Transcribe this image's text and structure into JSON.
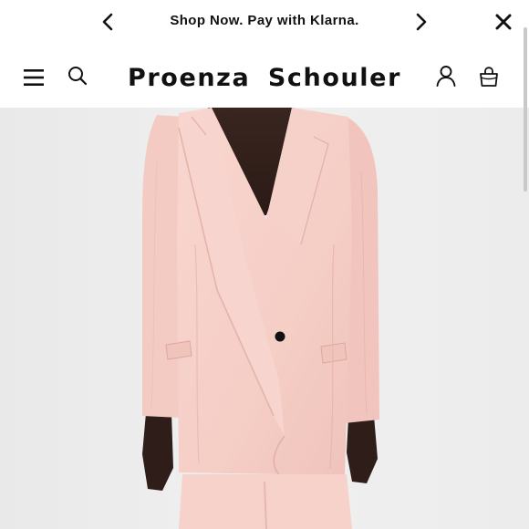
{
  "promo": {
    "message": "Shop Now. Pay with Klarna."
  },
  "header": {
    "brand_word_1": "Proenza",
    "brand_word_2": "Schouler"
  },
  "icons": {
    "prev": "chevron-left-icon",
    "next": "chevron-right-icon",
    "close": "close-icon",
    "menu": "hamburger-menu-icon",
    "search": "search-icon",
    "account": "user-icon",
    "bag": "shopping-bag-icon"
  },
  "hero": {
    "subject": "model wearing pink oversized double-breasted blazer"
  },
  "colors": {
    "blazer": "#f6cfc8",
    "background": "#eeeeee",
    "text": "#111111"
  }
}
